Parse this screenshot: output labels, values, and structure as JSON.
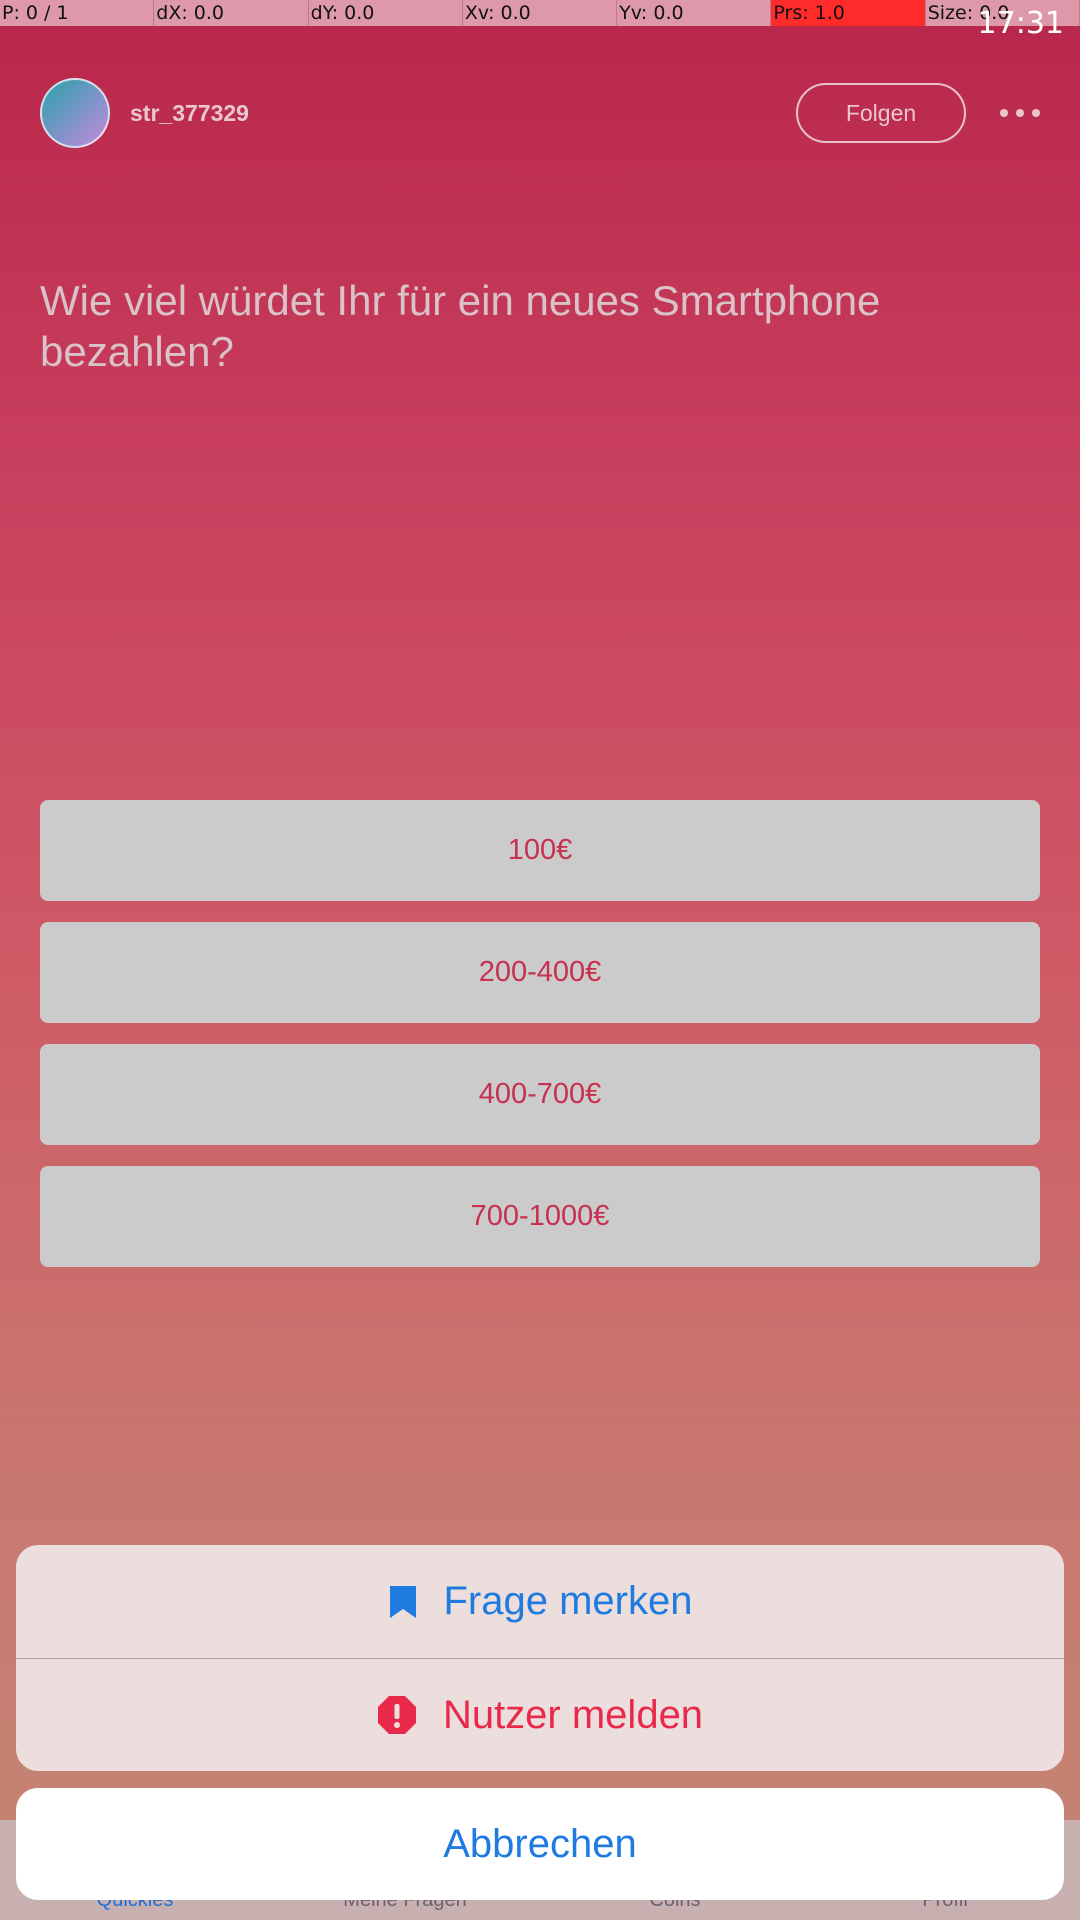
{
  "debug": {
    "pointer": "P: 0 / 1",
    "dx": "dX: 0.0",
    "dy": "dY: 0.0",
    "xv": "Xv: 0.0",
    "yv": "Yv: 0.0",
    "prs": "Prs: 1.0",
    "size": "Size: 0.0"
  },
  "status": {
    "time": "17:31"
  },
  "header": {
    "username": "str_377329",
    "follow_label": "Folgen",
    "more_icon": "more-horizontal-icon"
  },
  "question": "Wie viel würdet Ihr für ein neues Smartphone bezahlen?",
  "answers": [
    "100€",
    "200-400€",
    "400-700€",
    "700-1000€"
  ],
  "bottom_nav": {
    "items": [
      "Quickies",
      "Meine Fragen",
      "Coins",
      "Profil"
    ],
    "active": "Quickies"
  },
  "sheet": {
    "save_label": "Frage merken",
    "save_icon": "bookmark-icon",
    "report_label": "Nutzer melden",
    "report_icon": "alert-icon",
    "cancel_label": "Abbrechen"
  },
  "colors": {
    "accent_blue": "#1f7be0",
    "alert_red": "#e8294c",
    "answer_text": "#c7304e"
  }
}
